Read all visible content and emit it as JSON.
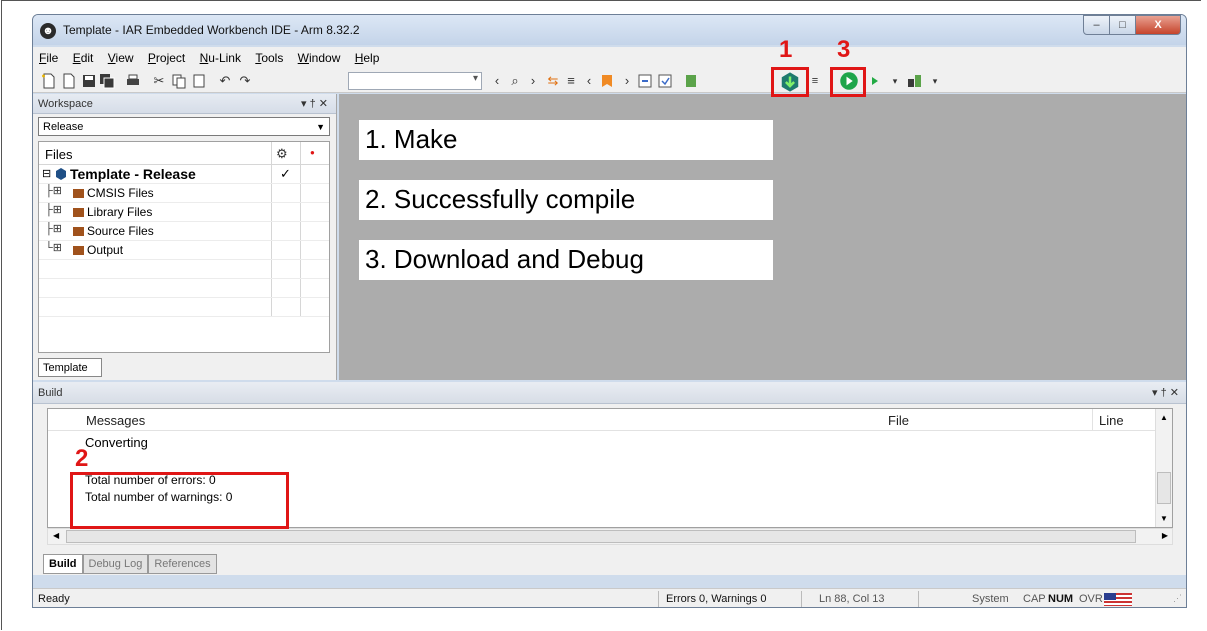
{
  "window": {
    "title": "Template - IAR Embedded Workbench IDE - Arm 8.32.2",
    "min_glyph": "–",
    "max_glyph": "□",
    "close_glyph": "X",
    "logo_glyph": "☻"
  },
  "menubar": {
    "items": [
      {
        "u": "F",
        "rest": "ile"
      },
      {
        "u": "E",
        "rest": "dit"
      },
      {
        "u": "V",
        "rest": "iew"
      },
      {
        "u": "P",
        "rest": "roject"
      },
      {
        "u": "N",
        "rest": "u-Link"
      },
      {
        "u": "T",
        "rest": "ools"
      },
      {
        "u": "W",
        "rest": "indow"
      },
      {
        "u": "H",
        "rest": "elp"
      }
    ]
  },
  "toolbar": {
    "combo_arrow": "▾"
  },
  "workspace": {
    "header": "Workspace",
    "header_ctl": "▾ † ✕",
    "config": "Release",
    "config_arrow": "▼",
    "files_header": "Files",
    "gear_glyph": "⚙",
    "dot_glyph": "●",
    "project": "Template - Release",
    "project_check": "✓",
    "groups": [
      "CMSIS Files",
      "Library Files",
      "Source Files",
      "Output"
    ],
    "tab": "Template"
  },
  "annotations": {
    "make": "1. Make",
    "compile": "2. Successfully compile",
    "debug": "3. Download and Debug",
    "n1": "1",
    "n2": "2",
    "n3": "3"
  },
  "build": {
    "header": "Build",
    "header_ctl": "▾ † ✕",
    "col_messages": "Messages",
    "col_file": "File",
    "col_line": "Line",
    "line1": "Converting",
    "line2": "Total number of errors: 0",
    "line3": "Total number of warnings: 0",
    "tabs": [
      "Build",
      "Debug Log",
      "References"
    ]
  },
  "status": {
    "ready": "Ready",
    "errors": "Errors 0, Warnings 0",
    "position": "Ln 88, Col 13",
    "system": "System",
    "cap": "CAP",
    "num": "NUM",
    "ovr": "OVR"
  }
}
